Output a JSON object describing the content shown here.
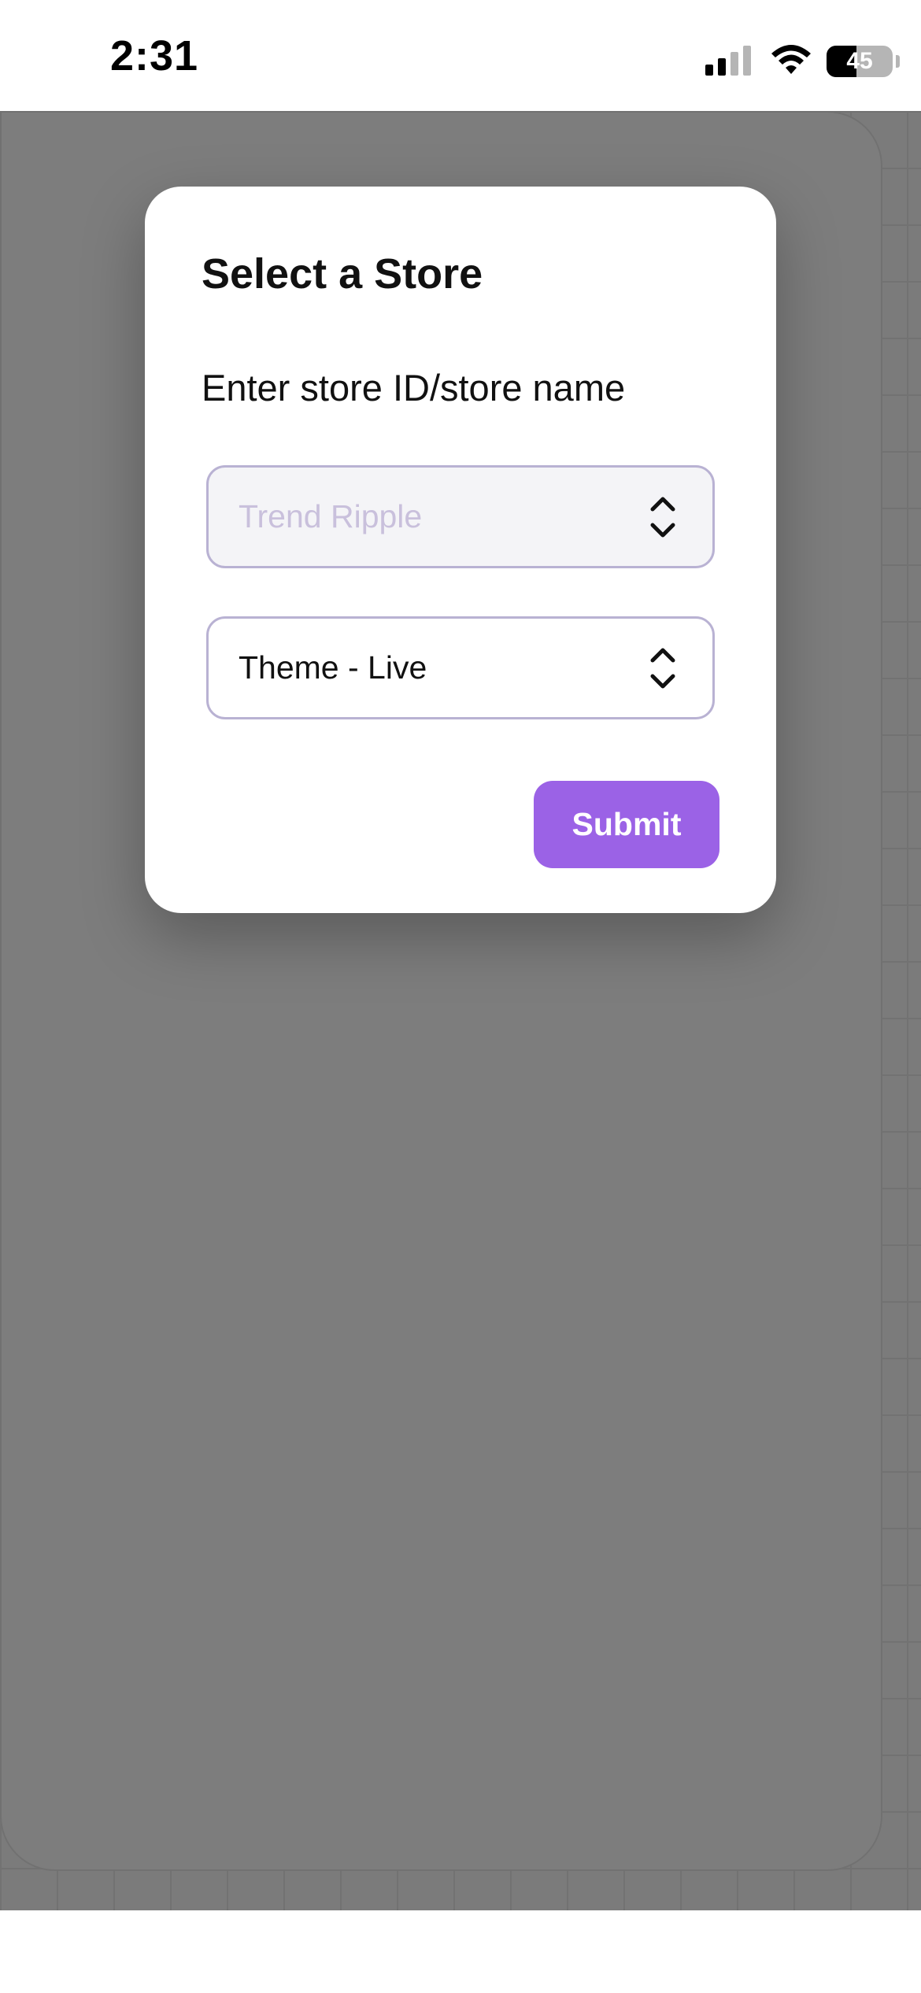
{
  "status_bar": {
    "time": "2:31",
    "battery_level": "45",
    "icons": [
      "signal-icon",
      "wifi-icon",
      "battery-icon"
    ]
  },
  "modal": {
    "title": "Select a Store",
    "label": "Enter store ID/store name",
    "store_select": {
      "placeholder": "Trend Ripple",
      "icon": "chevron-up-down-icon"
    },
    "theme_select": {
      "value": "Theme - Live",
      "icon": "chevron-up-down-icon"
    },
    "submit_label": "Submit"
  },
  "colors": {
    "accent": "#9b62e6",
    "field_border": "#b9b2d3",
    "placeholder": "#c9c0dc",
    "overlay": "rgba(0,0,0,0.5)"
  }
}
